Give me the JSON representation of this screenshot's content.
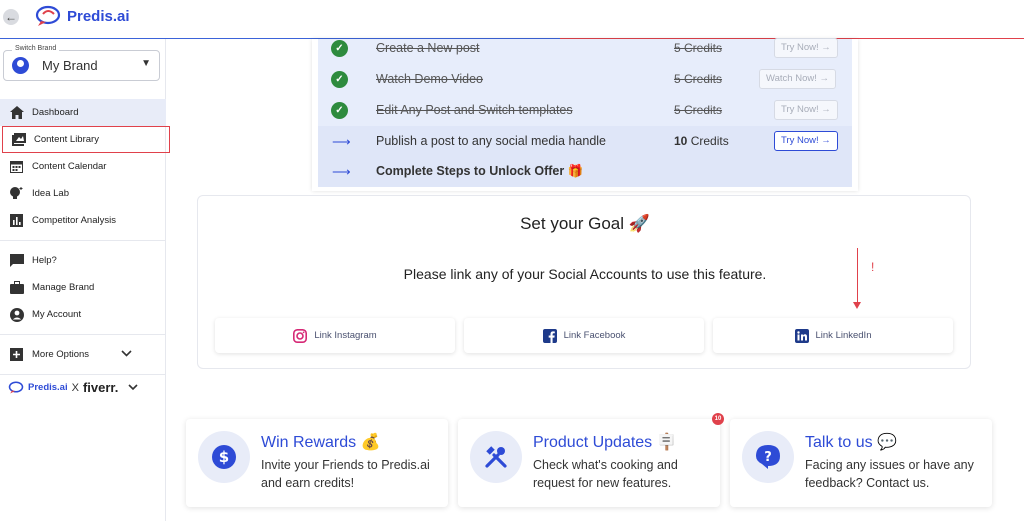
{
  "app": {
    "name": "Predis.ai"
  },
  "brand_switcher": {
    "caption": "Switch Brand",
    "value": "My Brand"
  },
  "sidebar": {
    "items": [
      {
        "label": "Dashboard",
        "icon": "home-icon"
      },
      {
        "label": "Content Library",
        "icon": "image-library-icon"
      },
      {
        "label": "Content Calendar",
        "icon": "calendar-icon"
      },
      {
        "label": "Idea Lab",
        "icon": "lightbulb-icon"
      },
      {
        "label": "Competitor Analysis",
        "icon": "analytics-icon"
      },
      {
        "label": "Help?",
        "icon": "chat-icon"
      },
      {
        "label": "Manage Brand",
        "icon": "briefcase-icon"
      },
      {
        "label": "My Account",
        "icon": "account-icon"
      },
      {
        "label": "More Options",
        "icon": "plus-square-icon"
      }
    ],
    "collab": {
      "left": "Predis.ai",
      "x": "X",
      "right": "fiverr."
    }
  },
  "checklist": {
    "rows": [
      {
        "label": "Create a New post",
        "credits": "5 Credits",
        "button": "Try Now! →",
        "done": true
      },
      {
        "label": "Watch Demo Video",
        "credits": "5 Credits",
        "button": "Watch Now! →",
        "done": true
      },
      {
        "label": "Edit Any Post and Switch templates",
        "credits": "5 Credits",
        "button": "Try Now! →",
        "done": true
      },
      {
        "label": "Publish a post to any social media handle",
        "credits_num": "10",
        "credits_unit": "Credits",
        "button": "Try Now! →",
        "done": false
      },
      {
        "label": "Complete Steps to Unlock Offer 🎁",
        "done": false
      }
    ]
  },
  "goal": {
    "title": "Set your Goal 🚀",
    "message": "Please link any of your Social Accounts to use this feature.",
    "annotation": "!",
    "links": [
      {
        "label": "Link Instagram",
        "icon": "instagram-icon"
      },
      {
        "label": "Link Facebook",
        "icon": "facebook-icon"
      },
      {
        "label": "Link LinkedIn",
        "icon": "linkedin-icon"
      }
    ]
  },
  "cards": [
    {
      "title": "Win Rewards 💰",
      "desc": "Invite your Friends to Predis.ai and earn credits!",
      "icon": "dollar-icon"
    },
    {
      "title": "Product Updates 🪧",
      "desc": "Check what's cooking and request for new features.",
      "icon": "tools-icon",
      "badge": "10"
    },
    {
      "title": "Talk to us 💬",
      "desc": "Facing any issues or have any feedback? Contact us.",
      "icon": "question-icon"
    }
  ],
  "colors": {
    "accent": "#2e4bd6",
    "highlight": "#e0414b",
    "success": "#2e8b3e"
  }
}
